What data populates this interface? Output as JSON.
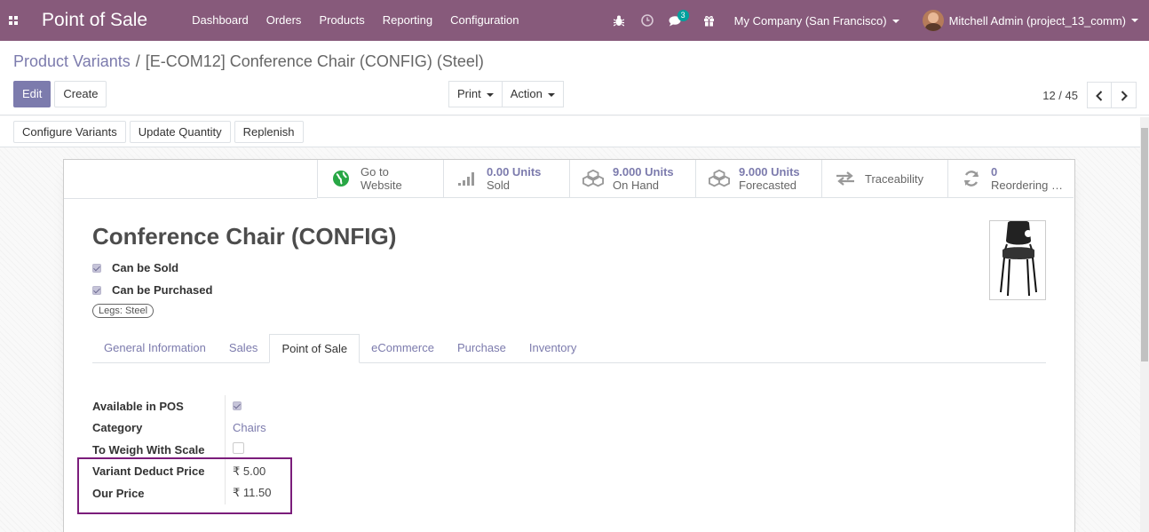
{
  "navbar": {
    "app_title": "Point of Sale",
    "menu": [
      "Dashboard",
      "Orders",
      "Products",
      "Reporting",
      "Configuration"
    ],
    "messages_count": "3",
    "company": "My Company (San Francisco)",
    "user": "Mitchell Admin (project_13_comm)"
  },
  "breadcrumb": {
    "parent": "Product Variants",
    "separator": "/",
    "current": "[E-COM12] Conference Chair (CONFIG) (Steel)"
  },
  "buttons": {
    "edit": "Edit",
    "create": "Create",
    "print": "Print",
    "action": "Action",
    "configure_variants": "Configure Variants",
    "update_quantity": "Update Quantity",
    "replenish": "Replenish"
  },
  "pager": {
    "value": "12 / 45"
  },
  "smart_buttons": [
    {
      "num": "Go to",
      "label": "Website",
      "icon": "globe-icon"
    },
    {
      "num": "0.00 Units",
      "label": "Sold",
      "icon": "signal-icon"
    },
    {
      "num": "9.000 Units",
      "label": "On Hand",
      "icon": "cubes-icon"
    },
    {
      "num": "9.000 Units",
      "label": "Forecasted",
      "icon": "cubes-icon"
    },
    {
      "num": "",
      "label": "Traceability",
      "icon": "exchange-icon"
    },
    {
      "num": "0",
      "label": "Reordering Rules",
      "icon": "refresh-icon"
    }
  ],
  "product": {
    "name": "Conference Chair (CONFIG)",
    "can_be_sold": "Can be Sold",
    "can_be_purchased": "Can be Purchased",
    "tag": "Legs: Steel"
  },
  "tabs": [
    "General Information",
    "Sales",
    "Point of Sale",
    "eCommerce",
    "Purchase",
    "Inventory"
  ],
  "active_tab": "Point of Sale",
  "fields": {
    "available_in_pos": {
      "label": "Available in POS",
      "checked": true
    },
    "category": {
      "label": "Category",
      "value": "Chairs"
    },
    "to_weigh": {
      "label": "To Weigh With Scale",
      "checked": false
    },
    "variant_deduct_price": {
      "label": "Variant Deduct Price",
      "value": "₹ 5.00"
    },
    "our_price": {
      "label": "Our Price",
      "value": "₹ 11.50"
    }
  },
  "colors": {
    "brand": "#875a7b",
    "link": "#7c7bad",
    "highlight": "#7b1d7b"
  }
}
